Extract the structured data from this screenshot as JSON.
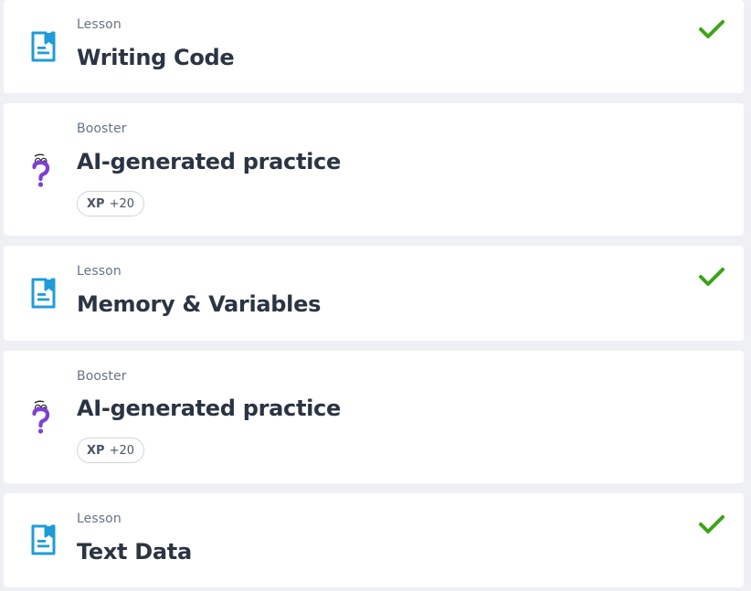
{
  "colors": {
    "lesson_icon": "#1f9bd9",
    "booster_icon": "#7e3fd6",
    "check": "#3ba514",
    "background": "#eef0f4"
  },
  "items": [
    {
      "type": "Lesson",
      "title": "Writing Code",
      "icon": "document-icon",
      "completed": true
    },
    {
      "type": "Booster",
      "title": "AI-generated practice",
      "icon": "question-mark-icon",
      "xp_label": "XP",
      "xp_amount": "+20",
      "completed": false
    },
    {
      "type": "Lesson",
      "title": "Memory & Variables",
      "icon": "document-icon",
      "completed": true
    },
    {
      "type": "Booster",
      "title": "AI-generated practice",
      "icon": "question-mark-icon",
      "xp_label": "XP",
      "xp_amount": "+20",
      "completed": false
    },
    {
      "type": "Lesson",
      "title": "Text Data",
      "icon": "document-icon",
      "completed": true
    }
  ]
}
